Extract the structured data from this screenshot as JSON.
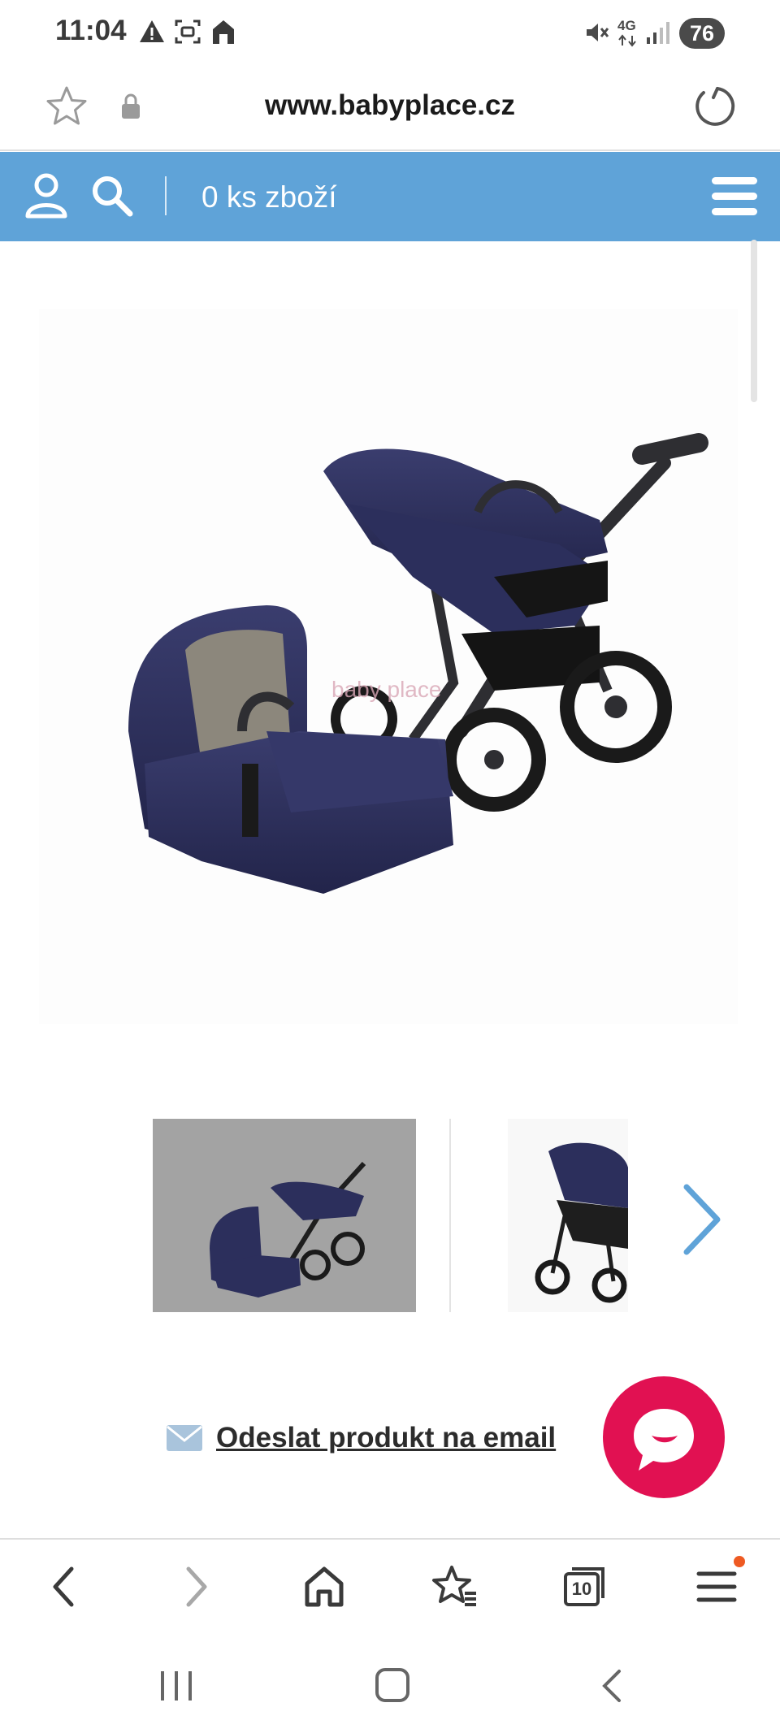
{
  "status_bar": {
    "time": "11:04",
    "network": "4G",
    "battery": "76"
  },
  "url_bar": {
    "url": "www.babyplace.cz"
  },
  "site_header": {
    "cart_label": "0 ks zboží",
    "color": "#5fa3d8"
  },
  "product": {
    "watermark": "baby place"
  },
  "actions": {
    "email_label": "Odeslat produkt na email"
  },
  "browser_nav": {
    "tabs_count": "10"
  },
  "colors": {
    "accent": "#5fa3d8",
    "chat": "#e11152"
  }
}
